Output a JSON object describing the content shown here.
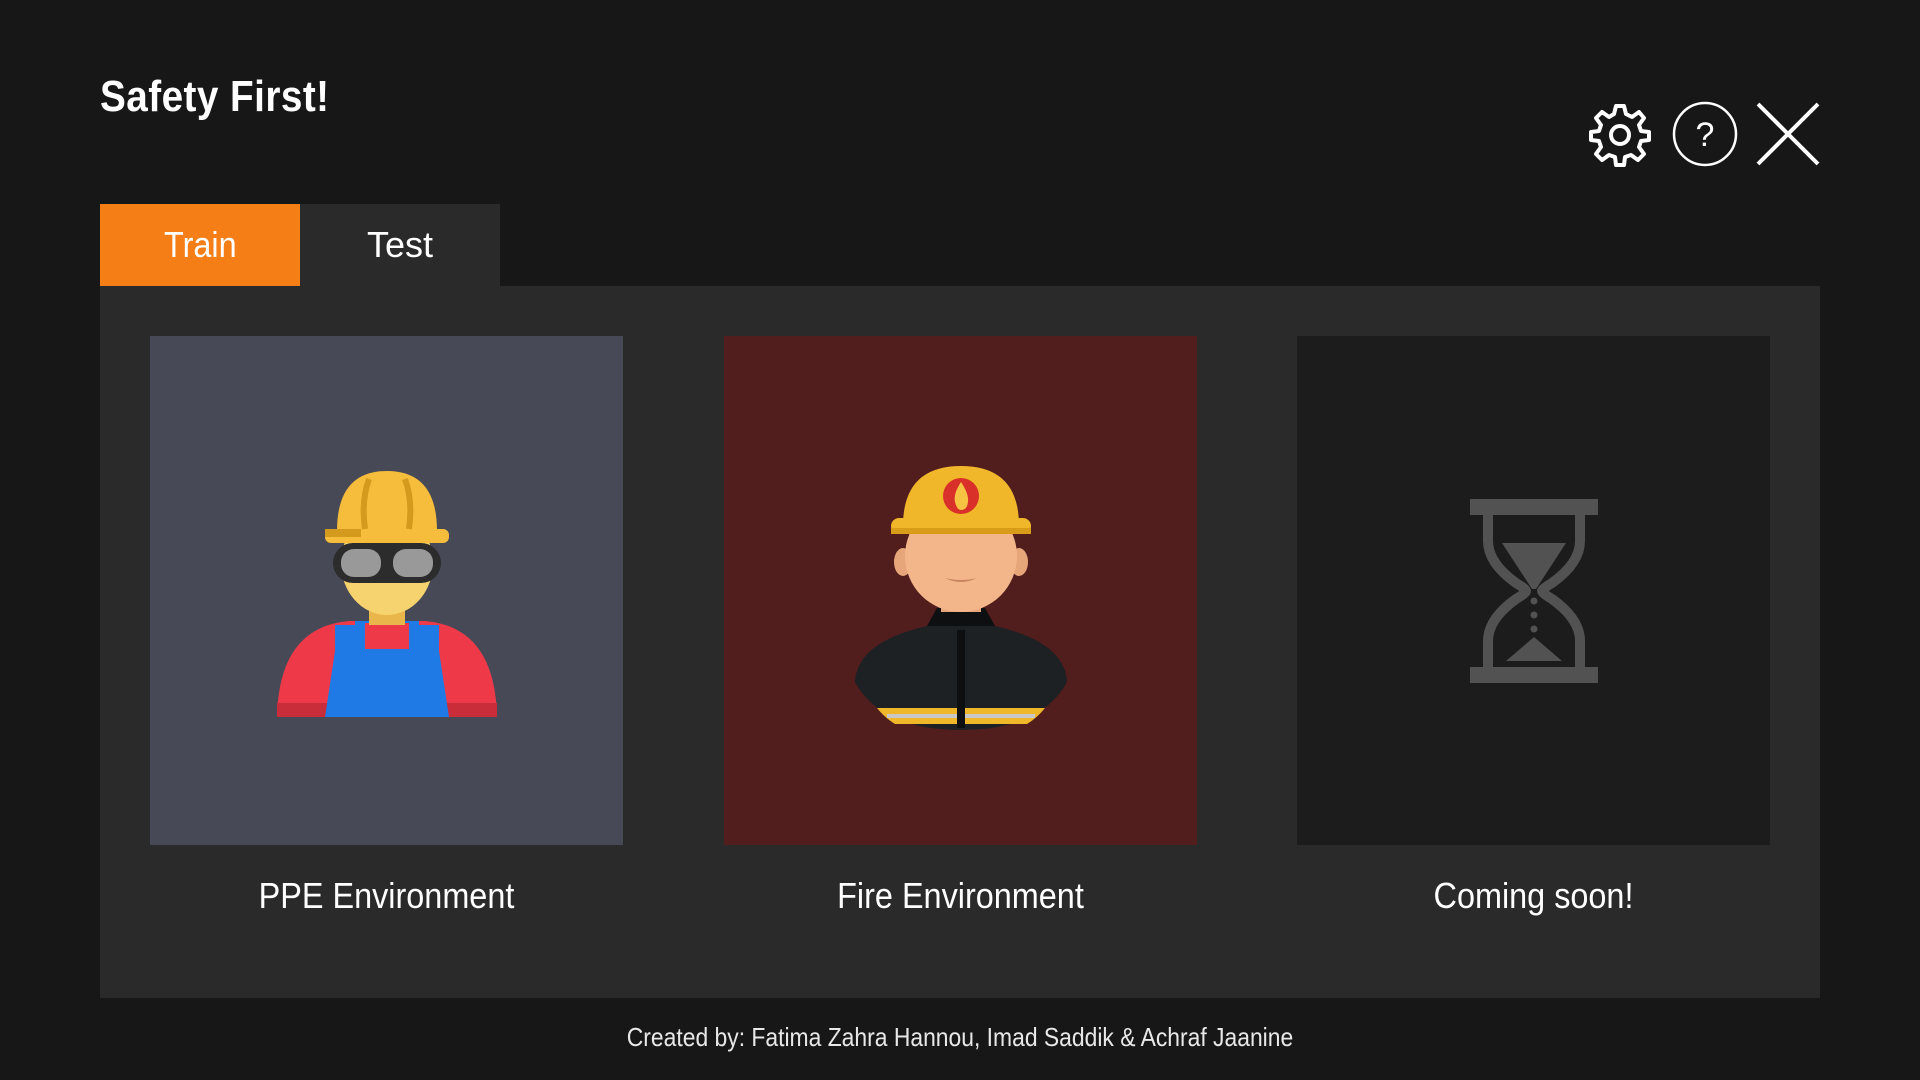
{
  "app": {
    "title": "Safety First!"
  },
  "toolbar": {
    "icons": [
      "gear-icon",
      "help-icon",
      "close-icon"
    ]
  },
  "tabs": [
    {
      "label": "Train",
      "active": true
    },
    {
      "label": "Test",
      "active": false
    }
  ],
  "cards": [
    {
      "label": "PPE Environment",
      "icon": "construction-worker-icon",
      "bg_color": "#474a56"
    },
    {
      "label": "Fire Environment",
      "icon": "firefighter-icon",
      "bg_color": "#511d1d"
    },
    {
      "label": "Coming soon!",
      "icon": "hourglass-icon",
      "bg_color": "#1c1c1c"
    }
  ],
  "footer": {
    "credits": "Created by: Fatima Zahra Hannou, Imad Saddik & Achraf Jaanine"
  },
  "colors": {
    "background": "#171718",
    "panel": "#2a2a2b",
    "accent": "#f57e17"
  }
}
